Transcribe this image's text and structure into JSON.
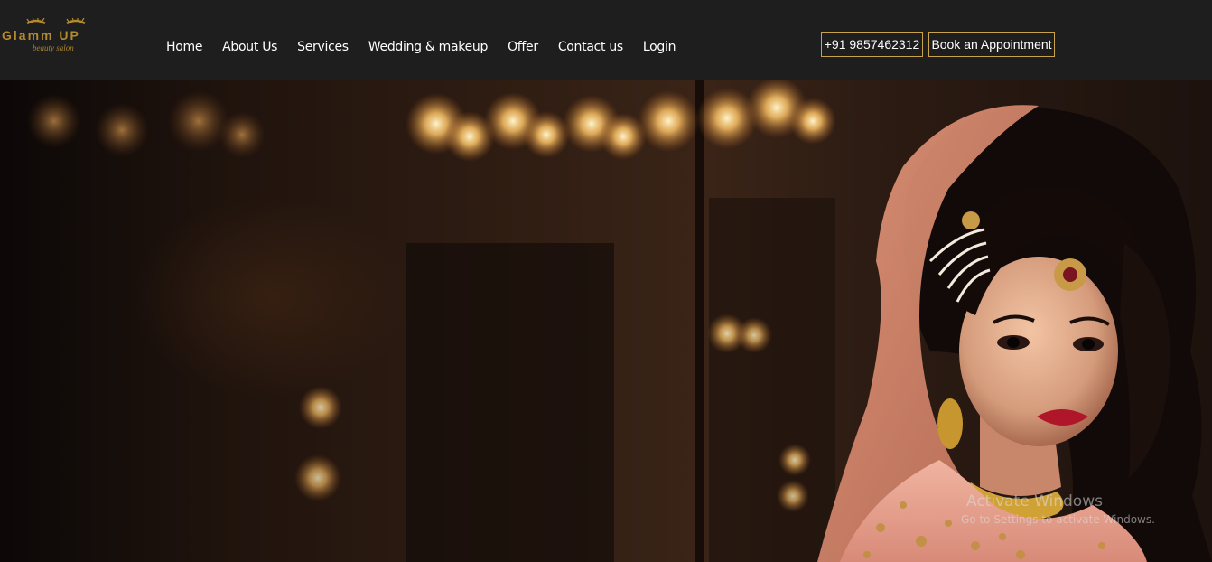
{
  "brand": {
    "name": "Glamm UP",
    "tagline": "beauty salon",
    "accent_color": "#b38b2e",
    "icon": "eyelash-logo-icon"
  },
  "nav": {
    "items": [
      {
        "label": "Home"
      },
      {
        "label": "About Us"
      },
      {
        "label": "Services"
      },
      {
        "label": "Wedding & makeup"
      },
      {
        "label": "Offer"
      },
      {
        "label": "Contact us"
      },
      {
        "label": "Login"
      }
    ]
  },
  "header": {
    "phone": "+91 9857462312",
    "book_label": "Book an Appointment"
  },
  "hero": {
    "image": "bridal-portrait-hero-image"
  },
  "watermark": {
    "title": "Activate Windows",
    "subtitle": "Go to Settings to activate Windows."
  },
  "colors": {
    "header_bg": "#1e1e1e",
    "border_gold": "#c9a24a"
  }
}
